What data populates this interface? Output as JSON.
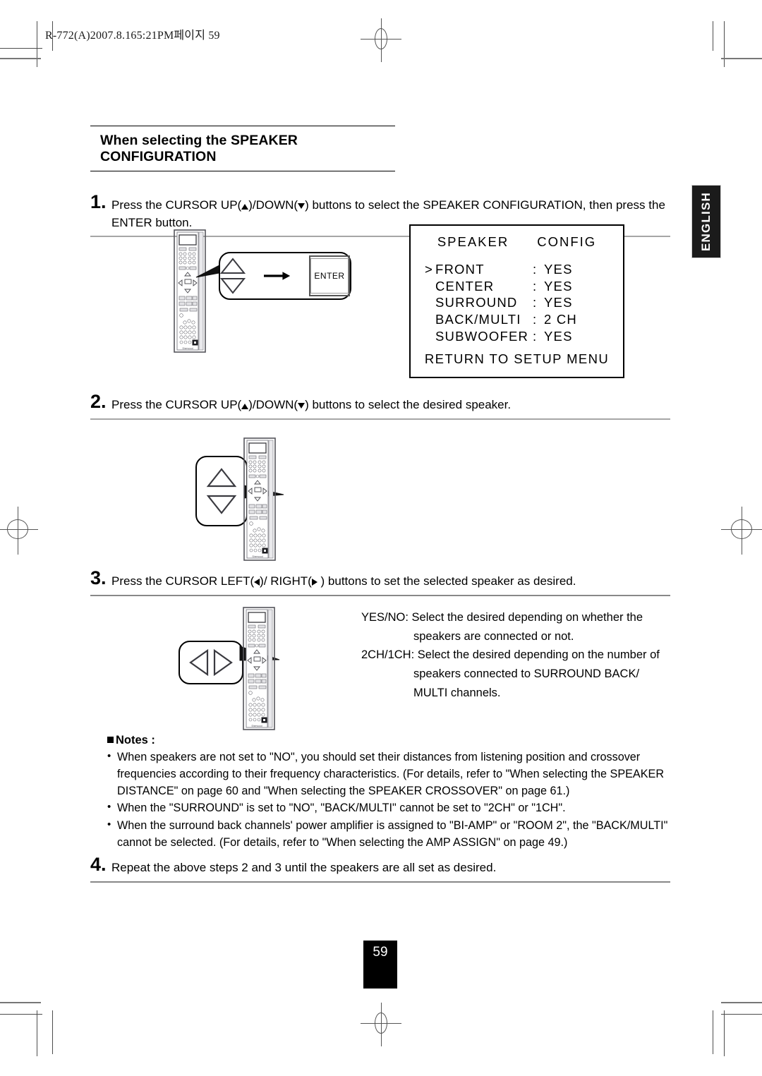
{
  "proof_header": "R-772(A)2007.8.165:21PM페이지 59",
  "side_tab": {
    "label": "ENGLISH"
  },
  "section": {
    "title": "When selecting the SPEAKER CONFIGURATION"
  },
  "steps": [
    {
      "number": "1.",
      "text_before_up": "Press the CURSOR UP(",
      "text_between": ")/DOWN(",
      "text_after_down": ") buttons to select the SPEAKER CONFIGURATION, then press the ENTER button."
    },
    {
      "number": "2.",
      "text_before_up": "Press the CURSOR UP(",
      "text_between": ")/DOWN(",
      "text_after_down": ") buttons to select the desired speaker."
    },
    {
      "number": "3.",
      "text_before_up": "Press the CURSOR LEFT(",
      "text_between": ")/ RIGHT(",
      "text_after_down": " ) buttons to set the selected speaker as desired."
    },
    {
      "number": "4.",
      "text_full": "Repeat the above steps 2 and 3 until the speakers are all set as desired."
    }
  ],
  "callouts": {
    "enter_label": "ENTER"
  },
  "osd": {
    "title_left": "SPEAKER",
    "title_right": "CONFIG",
    "rows": [
      {
        "caret": ">",
        "label": "FRONT",
        "colon": ":",
        "value": "YES"
      },
      {
        "caret": "",
        "label": "CENTER",
        "colon": ":",
        "value": "YES"
      },
      {
        "caret": "",
        "label": "SURROUND",
        "colon": ":",
        "value": "YES"
      },
      {
        "caret": "",
        "label": "BACK/MULTI",
        "colon": ":",
        "value": "2 CH"
      },
      {
        "caret": "",
        "label": "SUBWOOFER",
        "colon": ":",
        "value": "YES"
      }
    ],
    "footer": "RETURN TO SETUP MENU"
  },
  "step3_description": {
    "line1": "YES/NO: Select the desired depending on whether the",
    "line2": "speakers are connected or not.",
    "line3": "2CH/1CH: Select the desired depending on the number of",
    "line4": "speakers connected to SURROUND BACK/",
    "line5": "MULTI channels."
  },
  "notes": {
    "heading": "Notes :",
    "items": [
      "When speakers are not set to \"NO\", you should set their distances from listening position and crossover frequencies according to their frequency characteristics. (For details, refer to \"When selecting the SPEAKER DISTANCE\" on page 60 and \"When selecting the SPEAKER CROSSOVER\" on page 61.)",
      "When the \"SURROUND\" is set to \"NO\", \"BACK/MULTI\" cannot be set to \"2CH\" or \"1CH\".",
      "When the surround back channels' power amplifier is assigned to \"BI-AMP\" or \"ROOM 2\", the \"BACK/MULTI\" cannot be selected. (For details, refer to \"When selecting the AMP ASSIGN\" on page 49.)"
    ]
  },
  "page_number": "59",
  "colors": {
    "ink": "#000000",
    "tab_bg": "#1b1b1b",
    "rule": "#a6a6a6",
    "remote_body": "#6b6b72"
  }
}
